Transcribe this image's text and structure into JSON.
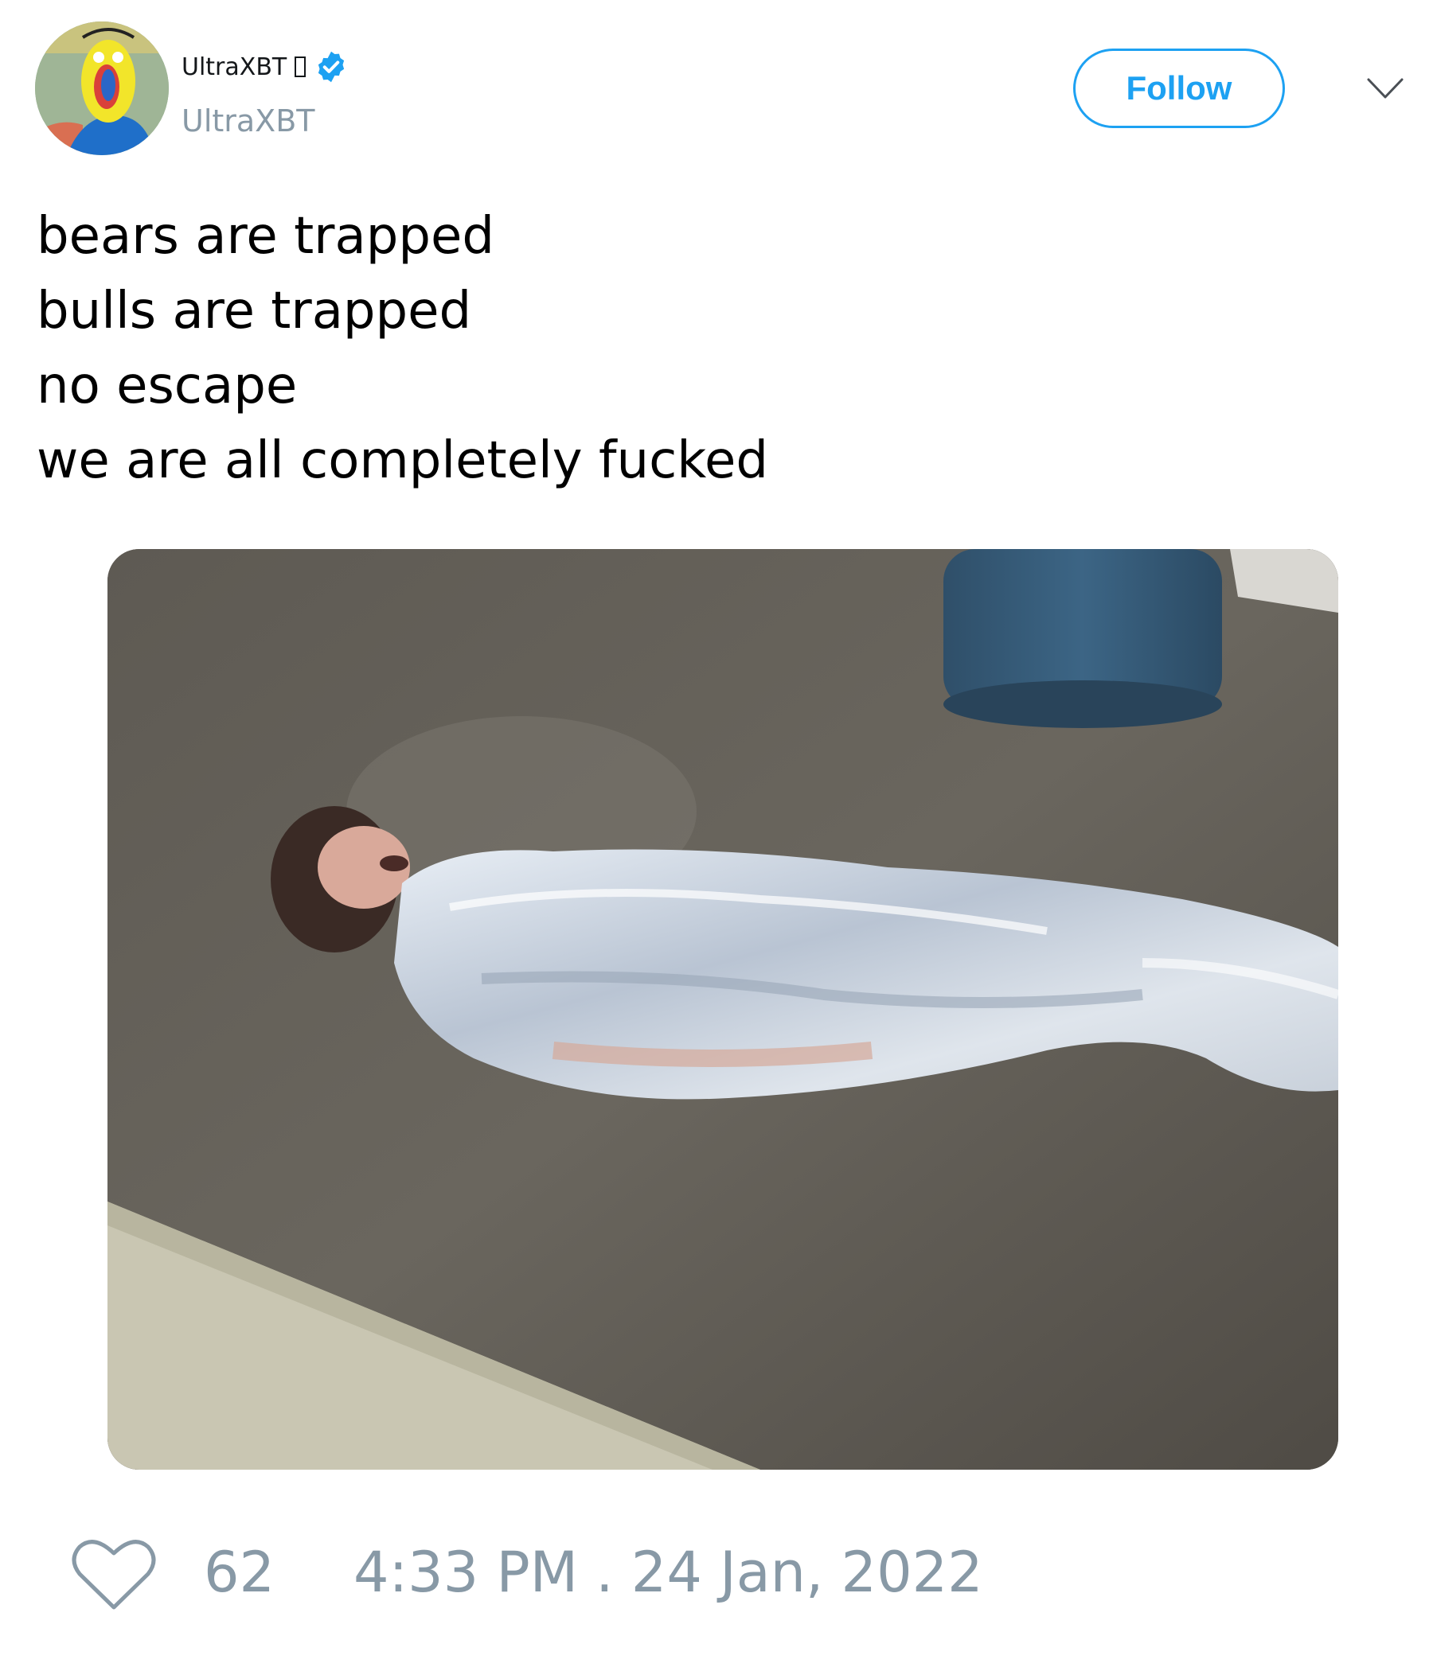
{
  "author": {
    "display_name": "UltraXBT",
    "handle": "UltraXBT",
    "verified_icon": "verified-badge-icon",
    "avatar": "avatar-image",
    "name_emoji": "missing-glyph-box"
  },
  "header": {
    "follow_label": "Follow",
    "menu_icon": "chevron-down-icon"
  },
  "tweet": {
    "lines": [
      "bears are trapped",
      "bulls are trapped",
      "no escape",
      "we are all completely fucked"
    ],
    "media": "photo-person-wrapped-in-plastic-on-floor"
  },
  "footer": {
    "like_icon": "heart-outline-icon",
    "like_count": "62",
    "timestamp": "4:33 PM . 24 Jan, 2022"
  },
  "colors": {
    "accent": "#1da1f2",
    "muted": "#8899a6",
    "text": "#000000"
  }
}
